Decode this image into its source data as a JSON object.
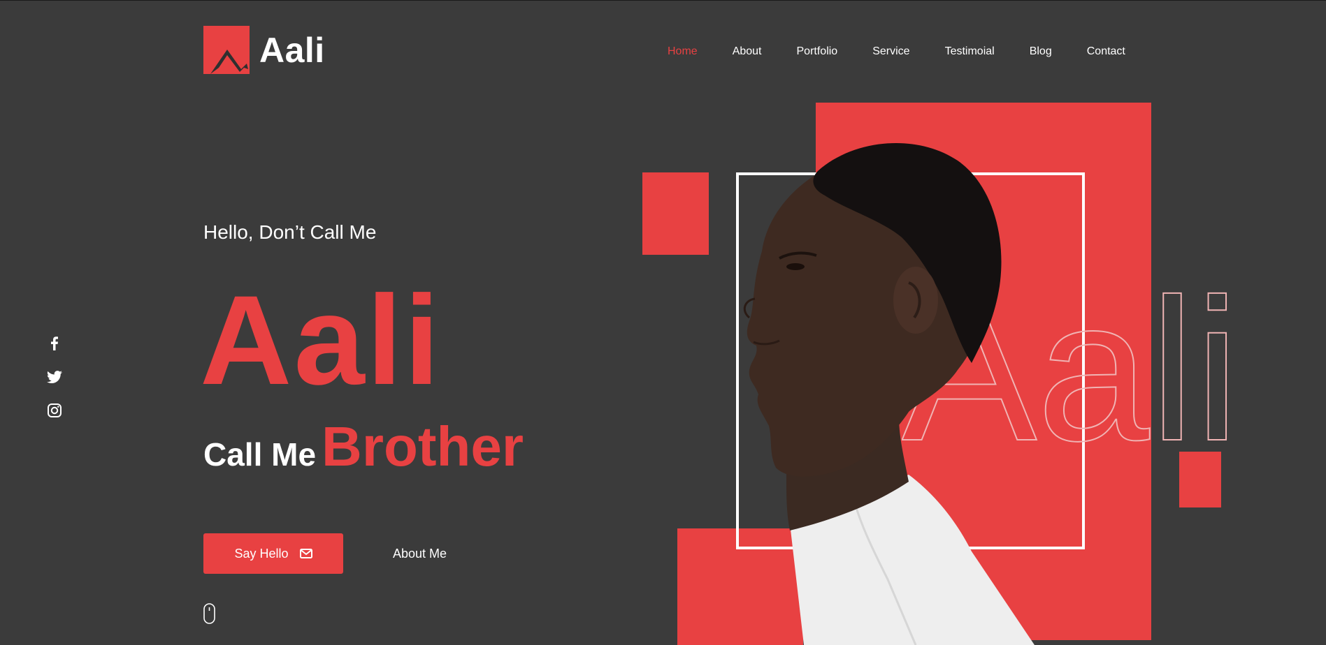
{
  "brand": {
    "name": "Aali"
  },
  "nav": {
    "items": [
      {
        "label": "Home",
        "active": true
      },
      {
        "label": "About",
        "active": false
      },
      {
        "label": "Portfolio",
        "active": false
      },
      {
        "label": "Service",
        "active": false
      },
      {
        "label": "Testimoial",
        "active": false
      },
      {
        "label": "Blog",
        "active": false
      },
      {
        "label": "Contact",
        "active": false
      }
    ]
  },
  "social": {
    "icons": [
      "facebook-icon",
      "twitter-icon",
      "instagram-icon"
    ]
  },
  "hero": {
    "greeting": "Hello, Don’t Call Me",
    "name": "Aali",
    "call_me": "Call Me",
    "nickname": "Brother",
    "cta_primary": "Say Hello",
    "cta_secondary": "About Me",
    "outline_text": "Aali"
  },
  "colors": {
    "accent": "#e84142",
    "background": "#3b3b3b",
    "text": "#ffffff"
  }
}
